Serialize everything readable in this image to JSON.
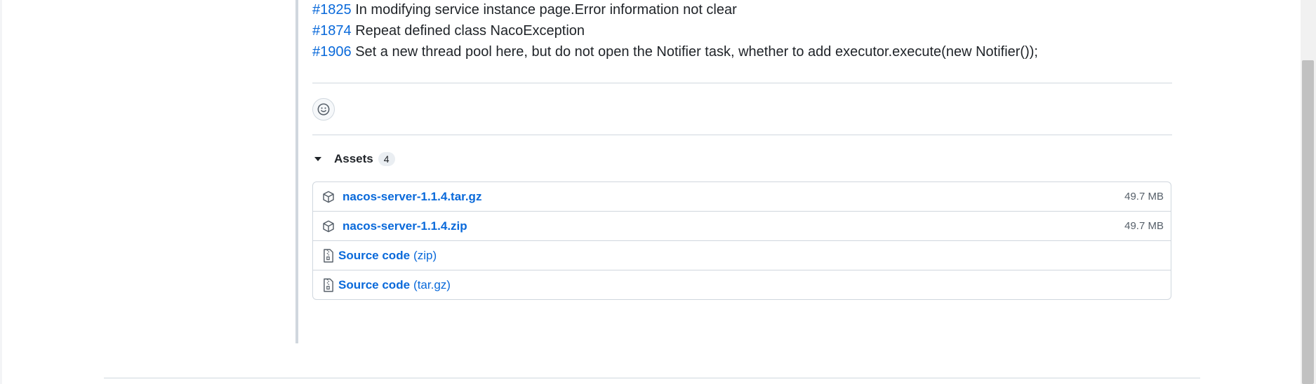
{
  "release_notes": [
    {
      "ref": "#1825",
      "text": "In modifying service instance page.Error information not clear"
    },
    {
      "ref": "#1874",
      "text": "Repeat defined class NacoException"
    },
    {
      "ref": "#1906",
      "text": "Set a new thread pool here, but do not open the Notifier task, whether to add executor.execute(new Notifier());"
    }
  ],
  "reactions": {
    "icon": "smiley-icon"
  },
  "assets": {
    "title": "Assets",
    "count": "4",
    "items": [
      {
        "name": "nacos-server-1.1.4.tar.gz",
        "size": "49.7 MB",
        "icon": "package-icon"
      },
      {
        "name": "nacos-server-1.1.4.zip",
        "size": "49.7 MB",
        "icon": "package-icon"
      },
      {
        "name": "Source code",
        "suffix": "(zip)",
        "icon": "file-zip-icon"
      },
      {
        "name": "Source code",
        "suffix": "(tar.gz)",
        "icon": "file-zip-icon"
      }
    ]
  },
  "colors": {
    "link": "#0969da",
    "border": "#d0d7de",
    "text": "#1f2328",
    "muted": "#57606a"
  }
}
